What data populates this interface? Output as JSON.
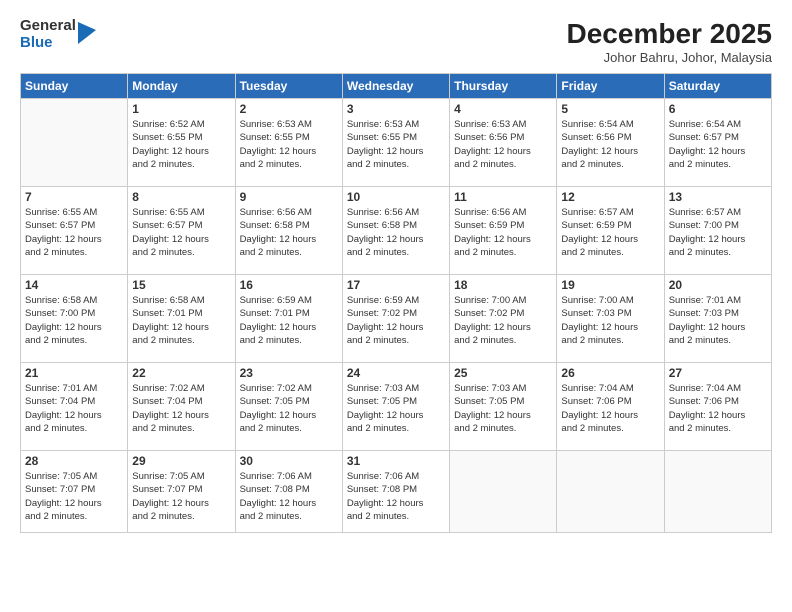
{
  "logo": {
    "general": "General",
    "blue": "Blue"
  },
  "title": "December 2025",
  "location": "Johor Bahru, Johor, Malaysia",
  "days_of_week": [
    "Sunday",
    "Monday",
    "Tuesday",
    "Wednesday",
    "Thursday",
    "Friday",
    "Saturday"
  ],
  "weeks": [
    [
      {
        "day": "",
        "info": ""
      },
      {
        "day": "1",
        "info": "Sunrise: 6:52 AM\nSunset: 6:55 PM\nDaylight: 12 hours\nand 2 minutes."
      },
      {
        "day": "2",
        "info": "Sunrise: 6:53 AM\nSunset: 6:55 PM\nDaylight: 12 hours\nand 2 minutes."
      },
      {
        "day": "3",
        "info": "Sunrise: 6:53 AM\nSunset: 6:55 PM\nDaylight: 12 hours\nand 2 minutes."
      },
      {
        "day": "4",
        "info": "Sunrise: 6:53 AM\nSunset: 6:56 PM\nDaylight: 12 hours\nand 2 minutes."
      },
      {
        "day": "5",
        "info": "Sunrise: 6:54 AM\nSunset: 6:56 PM\nDaylight: 12 hours\nand 2 minutes."
      },
      {
        "day": "6",
        "info": "Sunrise: 6:54 AM\nSunset: 6:57 PM\nDaylight: 12 hours\nand 2 minutes."
      }
    ],
    [
      {
        "day": "7",
        "info": "Sunrise: 6:55 AM\nSunset: 6:57 PM\nDaylight: 12 hours\nand 2 minutes."
      },
      {
        "day": "8",
        "info": "Sunrise: 6:55 AM\nSunset: 6:57 PM\nDaylight: 12 hours\nand 2 minutes."
      },
      {
        "day": "9",
        "info": "Sunrise: 6:56 AM\nSunset: 6:58 PM\nDaylight: 12 hours\nand 2 minutes."
      },
      {
        "day": "10",
        "info": "Sunrise: 6:56 AM\nSunset: 6:58 PM\nDaylight: 12 hours\nand 2 minutes."
      },
      {
        "day": "11",
        "info": "Sunrise: 6:56 AM\nSunset: 6:59 PM\nDaylight: 12 hours\nand 2 minutes."
      },
      {
        "day": "12",
        "info": "Sunrise: 6:57 AM\nSunset: 6:59 PM\nDaylight: 12 hours\nand 2 minutes."
      },
      {
        "day": "13",
        "info": "Sunrise: 6:57 AM\nSunset: 7:00 PM\nDaylight: 12 hours\nand 2 minutes."
      }
    ],
    [
      {
        "day": "14",
        "info": "Sunrise: 6:58 AM\nSunset: 7:00 PM\nDaylight: 12 hours\nand 2 minutes."
      },
      {
        "day": "15",
        "info": "Sunrise: 6:58 AM\nSunset: 7:01 PM\nDaylight: 12 hours\nand 2 minutes."
      },
      {
        "day": "16",
        "info": "Sunrise: 6:59 AM\nSunset: 7:01 PM\nDaylight: 12 hours\nand 2 minutes."
      },
      {
        "day": "17",
        "info": "Sunrise: 6:59 AM\nSunset: 7:02 PM\nDaylight: 12 hours\nand 2 minutes."
      },
      {
        "day": "18",
        "info": "Sunrise: 7:00 AM\nSunset: 7:02 PM\nDaylight: 12 hours\nand 2 minutes."
      },
      {
        "day": "19",
        "info": "Sunrise: 7:00 AM\nSunset: 7:03 PM\nDaylight: 12 hours\nand 2 minutes."
      },
      {
        "day": "20",
        "info": "Sunrise: 7:01 AM\nSunset: 7:03 PM\nDaylight: 12 hours\nand 2 minutes."
      }
    ],
    [
      {
        "day": "21",
        "info": "Sunrise: 7:01 AM\nSunset: 7:04 PM\nDaylight: 12 hours\nand 2 minutes."
      },
      {
        "day": "22",
        "info": "Sunrise: 7:02 AM\nSunset: 7:04 PM\nDaylight: 12 hours\nand 2 minutes."
      },
      {
        "day": "23",
        "info": "Sunrise: 7:02 AM\nSunset: 7:05 PM\nDaylight: 12 hours\nand 2 minutes."
      },
      {
        "day": "24",
        "info": "Sunrise: 7:03 AM\nSunset: 7:05 PM\nDaylight: 12 hours\nand 2 minutes."
      },
      {
        "day": "25",
        "info": "Sunrise: 7:03 AM\nSunset: 7:05 PM\nDaylight: 12 hours\nand 2 minutes."
      },
      {
        "day": "26",
        "info": "Sunrise: 7:04 AM\nSunset: 7:06 PM\nDaylight: 12 hours\nand 2 minutes."
      },
      {
        "day": "27",
        "info": "Sunrise: 7:04 AM\nSunset: 7:06 PM\nDaylight: 12 hours\nand 2 minutes."
      }
    ],
    [
      {
        "day": "28",
        "info": "Sunrise: 7:05 AM\nSunset: 7:07 PM\nDaylight: 12 hours\nand 2 minutes."
      },
      {
        "day": "29",
        "info": "Sunrise: 7:05 AM\nSunset: 7:07 PM\nDaylight: 12 hours\nand 2 minutes."
      },
      {
        "day": "30",
        "info": "Sunrise: 7:06 AM\nSunset: 7:08 PM\nDaylight: 12 hours\nand 2 minutes."
      },
      {
        "day": "31",
        "info": "Sunrise: 7:06 AM\nSunset: 7:08 PM\nDaylight: 12 hours\nand 2 minutes."
      },
      {
        "day": "",
        "info": ""
      },
      {
        "day": "",
        "info": ""
      },
      {
        "day": "",
        "info": ""
      }
    ]
  ]
}
